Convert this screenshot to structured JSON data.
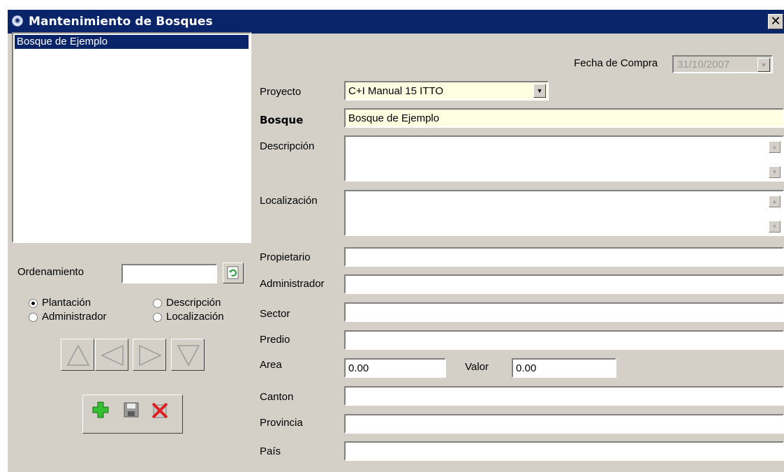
{
  "window": {
    "title": "Mantenimiento de Bosques",
    "close_glyph": "✕"
  },
  "list": {
    "items": [
      "Bosque de Ejemplo"
    ],
    "selected_index": 0
  },
  "sort": {
    "label": "Ordenamiento",
    "value": "",
    "options": [
      "Plantación",
      "Descripción",
      "Administrador",
      "Localización"
    ],
    "selected": "Plantación"
  },
  "form": {
    "fecha_compra": {
      "label": "Fecha de Compra",
      "value": "31/10/2007"
    },
    "proyecto": {
      "label": "Proyecto",
      "value": "C+I Manual 15 ITTO"
    },
    "bosque": {
      "label": "Bosque",
      "value": "Bosque de Ejemplo"
    },
    "descripcion": {
      "label": "Descripción",
      "value": ""
    },
    "localizacion": {
      "label": "Localización",
      "value": ""
    },
    "propietario": {
      "label": "Propietario",
      "value": ""
    },
    "administrador": {
      "label": "Administrador",
      "value": ""
    },
    "sector": {
      "label": "Sector",
      "value": ""
    },
    "predio": {
      "label": "Predio",
      "value": ""
    },
    "area": {
      "label": "Area",
      "value": "0.00"
    },
    "valor": {
      "label": "Valor",
      "value": "0.00"
    },
    "canton": {
      "label": "Canton",
      "value": ""
    },
    "provincia": {
      "label": "Provincia",
      "value": ""
    },
    "pais": {
      "label": "País",
      "value": ""
    }
  },
  "icons": {
    "refresh": "refresh-icon",
    "nav": [
      "arrow-up-icon",
      "arrow-left-icon",
      "arrow-right-icon",
      "arrow-down-icon"
    ],
    "actions": [
      "add-icon",
      "save-icon",
      "delete-icon"
    ]
  },
  "colors": {
    "titlebar": "#0a246a",
    "selection": "#0a246a",
    "highlight_field": "#ffffe1",
    "dialog": "#d4d0c8"
  }
}
